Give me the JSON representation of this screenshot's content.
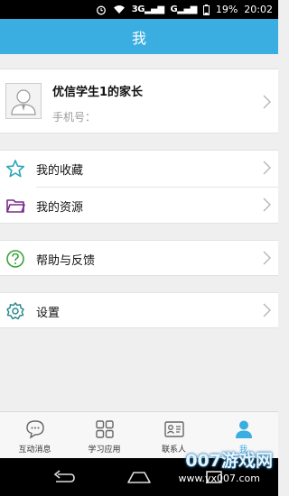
{
  "status_bar": {
    "network": "3G",
    "network2": "G",
    "battery": "19%",
    "time": "20:02"
  },
  "header": {
    "title": "我"
  },
  "profile": {
    "name": "优信学生1的家长",
    "phone_label": "手机号："
  },
  "menu": {
    "favorites": "我的收藏",
    "resources": "我的资源",
    "help": "帮助与反馈",
    "settings": "设置"
  },
  "tabs": [
    {
      "label": "互动消息",
      "icon": "chat-bubble-icon"
    },
    {
      "label": "学习应用",
      "icon": "apps-grid-icon"
    },
    {
      "label": "联系人",
      "icon": "contact-card-icon"
    },
    {
      "label": "我",
      "icon": "person-icon",
      "active": true
    }
  ],
  "colors": {
    "accent": "#3aaee1",
    "background": "#efefef"
  },
  "watermark": {
    "text": "007游戏网",
    "url": "www.yx007.com"
  }
}
